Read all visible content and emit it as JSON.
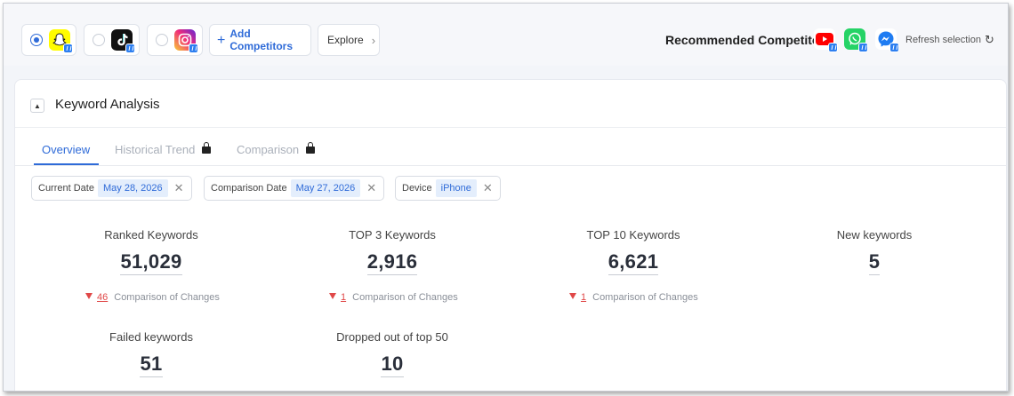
{
  "competitors": [
    {
      "name": "Snapchat",
      "icon": "snapchat-icon",
      "selected": true,
      "color": "#FFFC00"
    },
    {
      "name": "TikTok",
      "icon": "tiktok-icon",
      "selected": false,
      "color": "#111111"
    },
    {
      "name": "Instagram",
      "icon": "instagram-icon",
      "selected": false,
      "color": "#E1306C"
    }
  ],
  "toolbar": {
    "add_label": "Add Competitors",
    "explore_label": "Explore",
    "recommended_label": "Recommended Competitors",
    "refresh_label": "Refresh selection"
  },
  "recommended": [
    {
      "name": "YouTube",
      "icon": "youtube-icon",
      "color": "#FF0000"
    },
    {
      "name": "WhatsApp",
      "icon": "whatsapp-icon",
      "color": "#25D366"
    },
    {
      "name": "Messenger",
      "icon": "messenger-icon",
      "color": "#0084FF"
    }
  ],
  "panel": {
    "title": "Keyword Analysis",
    "tabs": [
      {
        "label": "Overview",
        "active": true,
        "locked": false
      },
      {
        "label": "Historical Trend",
        "active": false,
        "locked": true
      },
      {
        "label": "Comparison",
        "active": false,
        "locked": true
      }
    ],
    "filters": [
      {
        "label": "Current Date",
        "value": "May 28, 2026"
      },
      {
        "label": "Comparison Date",
        "value": "May 27, 2026"
      },
      {
        "label": "Device",
        "value": "iPhone"
      }
    ],
    "metrics": [
      {
        "label": "Ranked Keywords",
        "value": "51,029",
        "change": "46",
        "change_text": "Comparison of Changes"
      },
      {
        "label": "TOP 3 Keywords",
        "value": "2,916",
        "change": "1",
        "change_text": "Comparison of Changes"
      },
      {
        "label": "TOP 10 Keywords",
        "value": "6,621",
        "change": "1",
        "change_text": "Comparison of Changes"
      },
      {
        "label": "New keywords",
        "value": "5"
      },
      {
        "label": "Failed keywords",
        "value": "51"
      },
      {
        "label": "Dropped out of top 50",
        "value": "10"
      }
    ]
  },
  "colors": {
    "accent": "#2F6BD8",
    "decrease": "#E04848",
    "filter_bg": "#E4EEFC"
  }
}
